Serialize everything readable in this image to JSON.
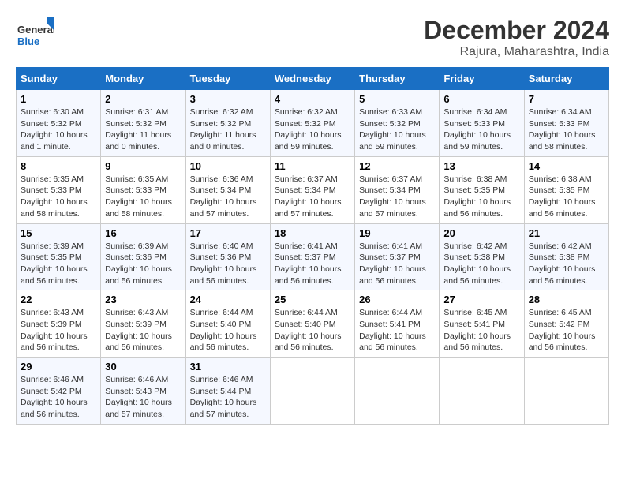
{
  "header": {
    "logo_general": "General",
    "logo_blue": "Blue",
    "title": "December 2024",
    "subtitle": "Rajura, Maharashtra, India"
  },
  "columns": [
    "Sunday",
    "Monday",
    "Tuesday",
    "Wednesday",
    "Thursday",
    "Friday",
    "Saturday"
  ],
  "weeks": [
    [
      {
        "day": "1",
        "sunrise": "6:30 AM",
        "sunset": "5:32 PM",
        "daylight": "10 hours and 1 minute."
      },
      {
        "day": "2",
        "sunrise": "6:31 AM",
        "sunset": "5:32 PM",
        "daylight": "11 hours and 0 minutes."
      },
      {
        "day": "3",
        "sunrise": "6:32 AM",
        "sunset": "5:32 PM",
        "daylight": "11 hours and 0 minutes."
      },
      {
        "day": "4",
        "sunrise": "6:32 AM",
        "sunset": "5:32 PM",
        "daylight": "10 hours and 59 minutes."
      },
      {
        "day": "5",
        "sunrise": "6:33 AM",
        "sunset": "5:32 PM",
        "daylight": "10 hours and 59 minutes."
      },
      {
        "day": "6",
        "sunrise": "6:34 AM",
        "sunset": "5:33 PM",
        "daylight": "10 hours and 59 minutes."
      },
      {
        "day": "7",
        "sunrise": "6:34 AM",
        "sunset": "5:33 PM",
        "daylight": "10 hours and 58 minutes."
      }
    ],
    [
      {
        "day": "8",
        "sunrise": "6:35 AM",
        "sunset": "5:33 PM",
        "daylight": "10 hours and 58 minutes."
      },
      {
        "day": "9",
        "sunrise": "6:35 AM",
        "sunset": "5:33 PM",
        "daylight": "10 hours and 58 minutes."
      },
      {
        "day": "10",
        "sunrise": "6:36 AM",
        "sunset": "5:34 PM",
        "daylight": "10 hours and 57 minutes."
      },
      {
        "day": "11",
        "sunrise": "6:37 AM",
        "sunset": "5:34 PM",
        "daylight": "10 hours and 57 minutes."
      },
      {
        "day": "12",
        "sunrise": "6:37 AM",
        "sunset": "5:34 PM",
        "daylight": "10 hours and 57 minutes."
      },
      {
        "day": "13",
        "sunrise": "6:38 AM",
        "sunset": "5:35 PM",
        "daylight": "10 hours and 56 minutes."
      },
      {
        "day": "14",
        "sunrise": "6:38 AM",
        "sunset": "5:35 PM",
        "daylight": "10 hours and 56 minutes."
      }
    ],
    [
      {
        "day": "15",
        "sunrise": "6:39 AM",
        "sunset": "5:35 PM",
        "daylight": "10 hours and 56 minutes."
      },
      {
        "day": "16",
        "sunrise": "6:39 AM",
        "sunset": "5:36 PM",
        "daylight": "10 hours and 56 minutes."
      },
      {
        "day": "17",
        "sunrise": "6:40 AM",
        "sunset": "5:36 PM",
        "daylight": "10 hours and 56 minutes."
      },
      {
        "day": "18",
        "sunrise": "6:41 AM",
        "sunset": "5:37 PM",
        "daylight": "10 hours and 56 minutes."
      },
      {
        "day": "19",
        "sunrise": "6:41 AM",
        "sunset": "5:37 PM",
        "daylight": "10 hours and 56 minutes."
      },
      {
        "day": "20",
        "sunrise": "6:42 AM",
        "sunset": "5:38 PM",
        "daylight": "10 hours and 56 minutes."
      },
      {
        "day": "21",
        "sunrise": "6:42 AM",
        "sunset": "5:38 PM",
        "daylight": "10 hours and 56 minutes."
      }
    ],
    [
      {
        "day": "22",
        "sunrise": "6:43 AM",
        "sunset": "5:39 PM",
        "daylight": "10 hours and 56 minutes."
      },
      {
        "day": "23",
        "sunrise": "6:43 AM",
        "sunset": "5:39 PM",
        "daylight": "10 hours and 56 minutes."
      },
      {
        "day": "24",
        "sunrise": "6:44 AM",
        "sunset": "5:40 PM",
        "daylight": "10 hours and 56 minutes."
      },
      {
        "day": "25",
        "sunrise": "6:44 AM",
        "sunset": "5:40 PM",
        "daylight": "10 hours and 56 minutes."
      },
      {
        "day": "26",
        "sunrise": "6:44 AM",
        "sunset": "5:41 PM",
        "daylight": "10 hours and 56 minutes."
      },
      {
        "day": "27",
        "sunrise": "6:45 AM",
        "sunset": "5:41 PM",
        "daylight": "10 hours and 56 minutes."
      },
      {
        "day": "28",
        "sunrise": "6:45 AM",
        "sunset": "5:42 PM",
        "daylight": "10 hours and 56 minutes."
      }
    ],
    [
      {
        "day": "29",
        "sunrise": "6:46 AM",
        "sunset": "5:42 PM",
        "daylight": "10 hours and 56 minutes."
      },
      {
        "day": "30",
        "sunrise": "6:46 AM",
        "sunset": "5:43 PM",
        "daylight": "10 hours and 57 minutes."
      },
      {
        "day": "31",
        "sunrise": "6:46 AM",
        "sunset": "5:44 PM",
        "daylight": "10 hours and 57 minutes."
      },
      null,
      null,
      null,
      null
    ]
  ]
}
